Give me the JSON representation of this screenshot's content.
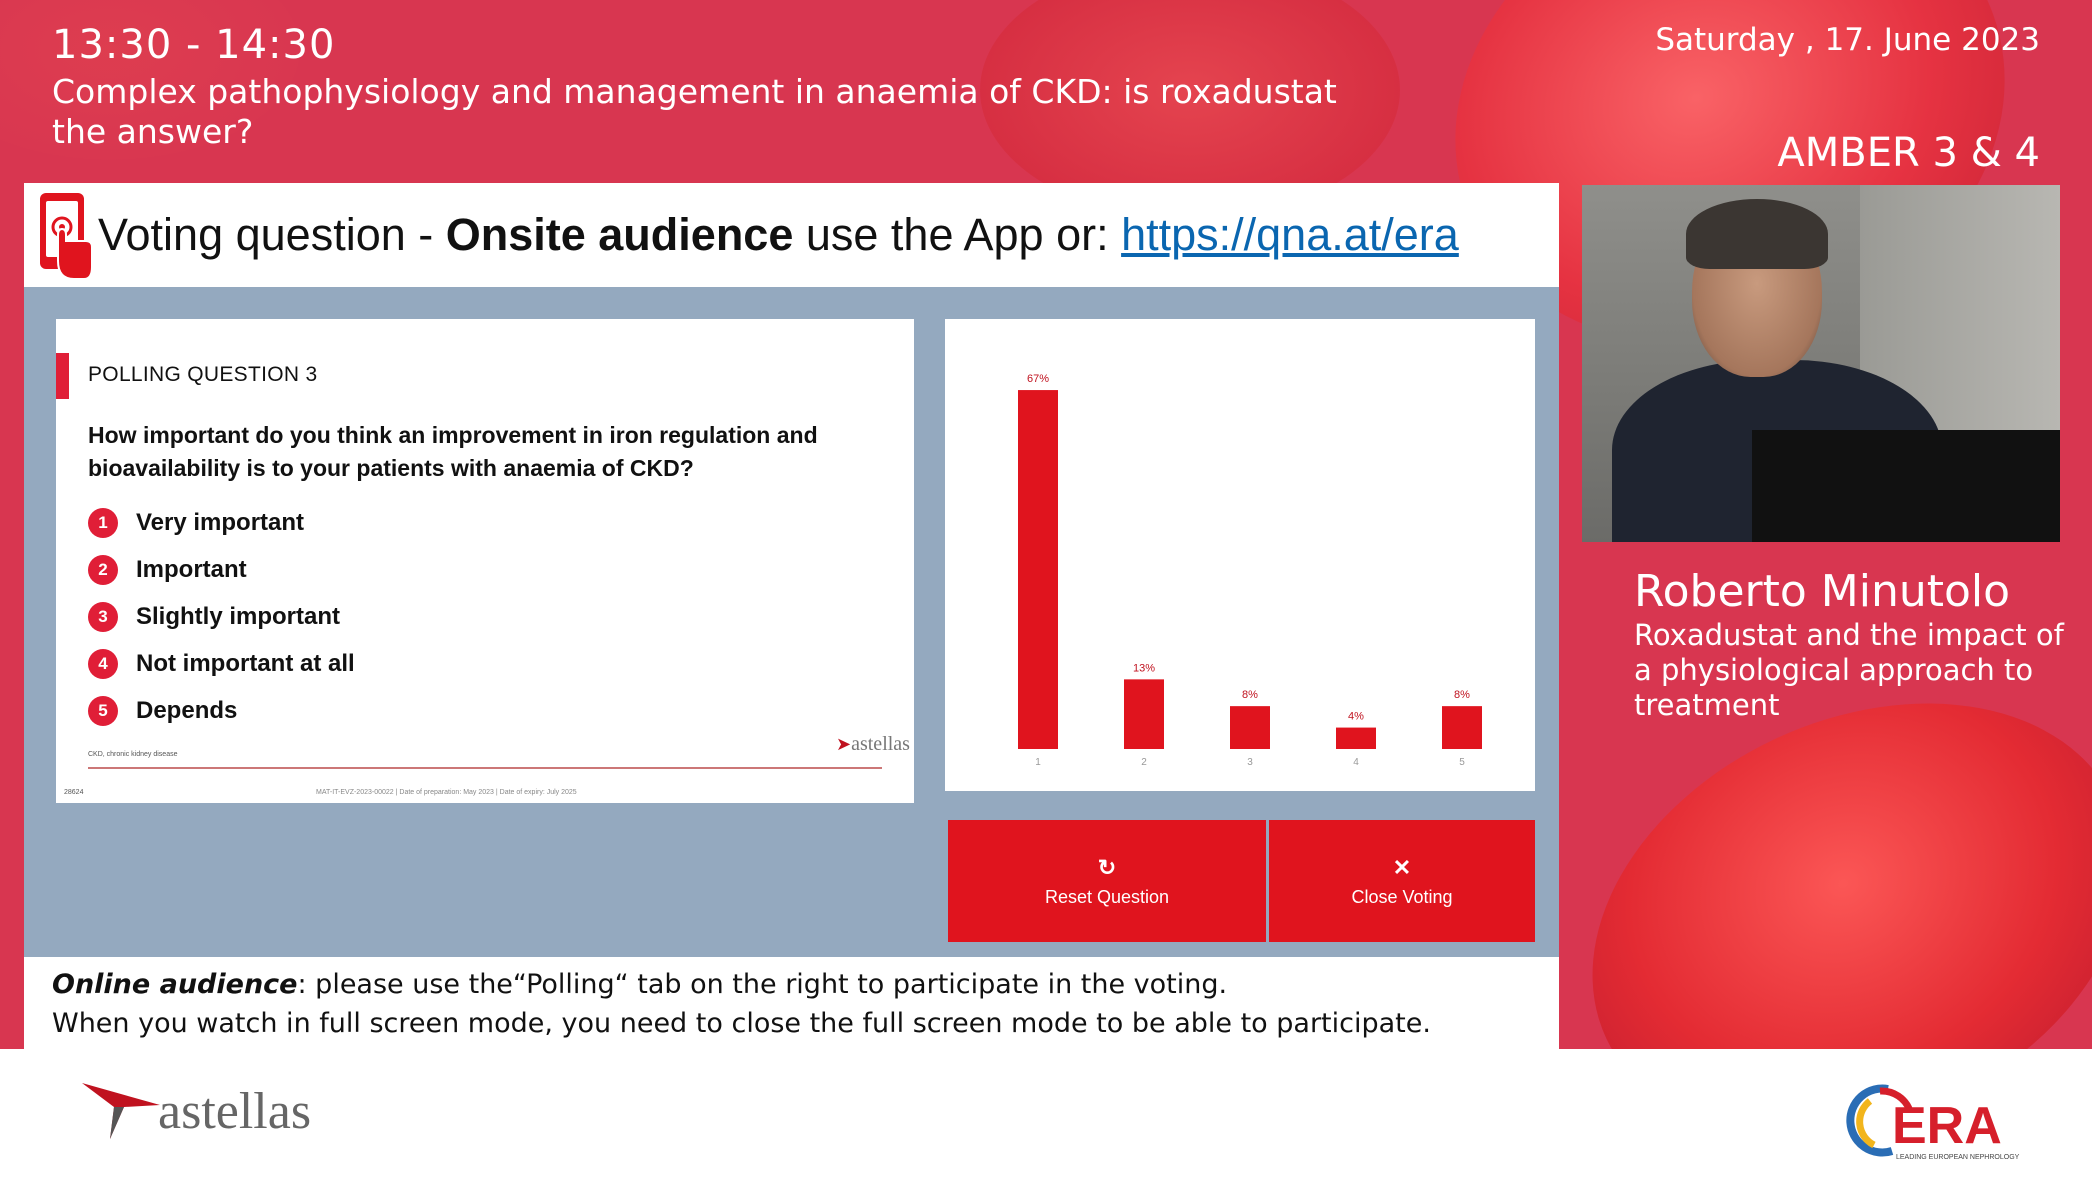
{
  "header": {
    "time": "13:30 - 14:30",
    "session_title": "Complex pathophysiology and management in anaemia of CKD: is roxadustat the answer?",
    "date": "Saturday , 17. June 2023",
    "room": "AMBER 3 & 4"
  },
  "voting": {
    "title_prefix": "Voting question - ",
    "title_bold": "Onsite audience",
    "title_mid": " use the App or: ",
    "title_link": "https://qna.at/era",
    "icon": "phone-touch-icon"
  },
  "slide": {
    "kicker": "POLLING QUESTION 3",
    "question": "How important do you think an improvement in iron regulation and bioavailability is to your patients with anaemia of CKD?",
    "options": [
      {
        "num": "1",
        "label": "Very important"
      },
      {
        "num": "2",
        "label": "Important"
      },
      {
        "num": "3",
        "label": "Slightly important"
      },
      {
        "num": "4",
        "label": "Not important at all"
      },
      {
        "num": "5",
        "label": "Depends"
      }
    ],
    "footnote": "CKD, chronic kidney disease",
    "logo_text": "astellas",
    "page_number": "28624",
    "legal": "MAT-IT-EVZ-2023-00022 | Date of preparation: May 2023 | Date of expiry: July 2025"
  },
  "chart_data": {
    "type": "bar",
    "categories": [
      "1",
      "2",
      "3",
      "4",
      "5"
    ],
    "values": [
      67,
      13,
      8,
      4,
      8
    ],
    "labels": [
      "67%",
      "13%",
      "8%",
      "4%",
      "8%"
    ],
    "ylim": [
      0,
      70
    ],
    "bar_color": "#e0141e",
    "grid": false
  },
  "buttons": {
    "reset_label": "Reset Question",
    "reset_icon": "refresh-icon",
    "close_label": "Close Voting",
    "close_icon": "close-icon"
  },
  "footer": {
    "online_em": "Online audience",
    "online_rest": ": please use the“Polling“ tab on the right to participate in the voting.",
    "line2": "When you watch in full screen mode, you need to close the full screen mode to be able to participate."
  },
  "speaker": {
    "name": "Roberto Minutolo",
    "topic": "Roxadustat and the impact of a physiological approach to treatment"
  },
  "branding": {
    "sponsor": "astellas",
    "organizer": "ERA",
    "organizer_tagline": "LEADING EUROPEAN NEPHROLOGY",
    "accent": "#e0141e",
    "background": "#d83650"
  }
}
